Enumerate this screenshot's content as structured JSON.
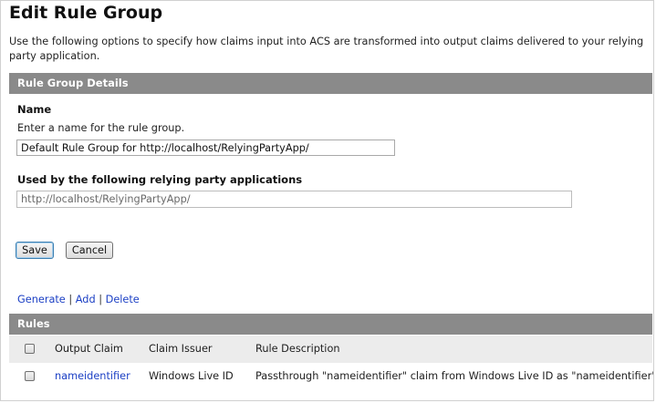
{
  "page": {
    "title": "Edit Rule Group",
    "intro": "Use the following options to specify how claims input into ACS are transformed into output claims delivered to your relying party application."
  },
  "details": {
    "header": "Rule Group Details",
    "name_label": "Name",
    "name_hint": "Enter a name for the rule group.",
    "name_value": "Default Rule Group for http://localhost/RelyingPartyApp/",
    "used_by_label": "Used by the following relying party applications",
    "used_by_value": "http://localhost/RelyingPartyApp/"
  },
  "actions": {
    "save_label": "Save",
    "cancel_label": "Cancel"
  },
  "rule_links": {
    "generate": "Generate",
    "separator": "|",
    "add": "Add",
    "delete": "Delete"
  },
  "rules": {
    "header": "Rules",
    "columns": [
      "Output Claim",
      "Claim Issuer",
      "Rule Description"
    ],
    "rows": [
      {
        "output_claim": "nameidentifier",
        "claim_issuer": "Windows Live ID",
        "description": "Passthrough \"nameidentifier\" claim from Windows Live ID as \"nameidentifier\""
      }
    ]
  },
  "colors": {
    "section_bar": "#8a8a8a",
    "link": "#1b3fc4",
    "grid_header": "#ececec"
  }
}
